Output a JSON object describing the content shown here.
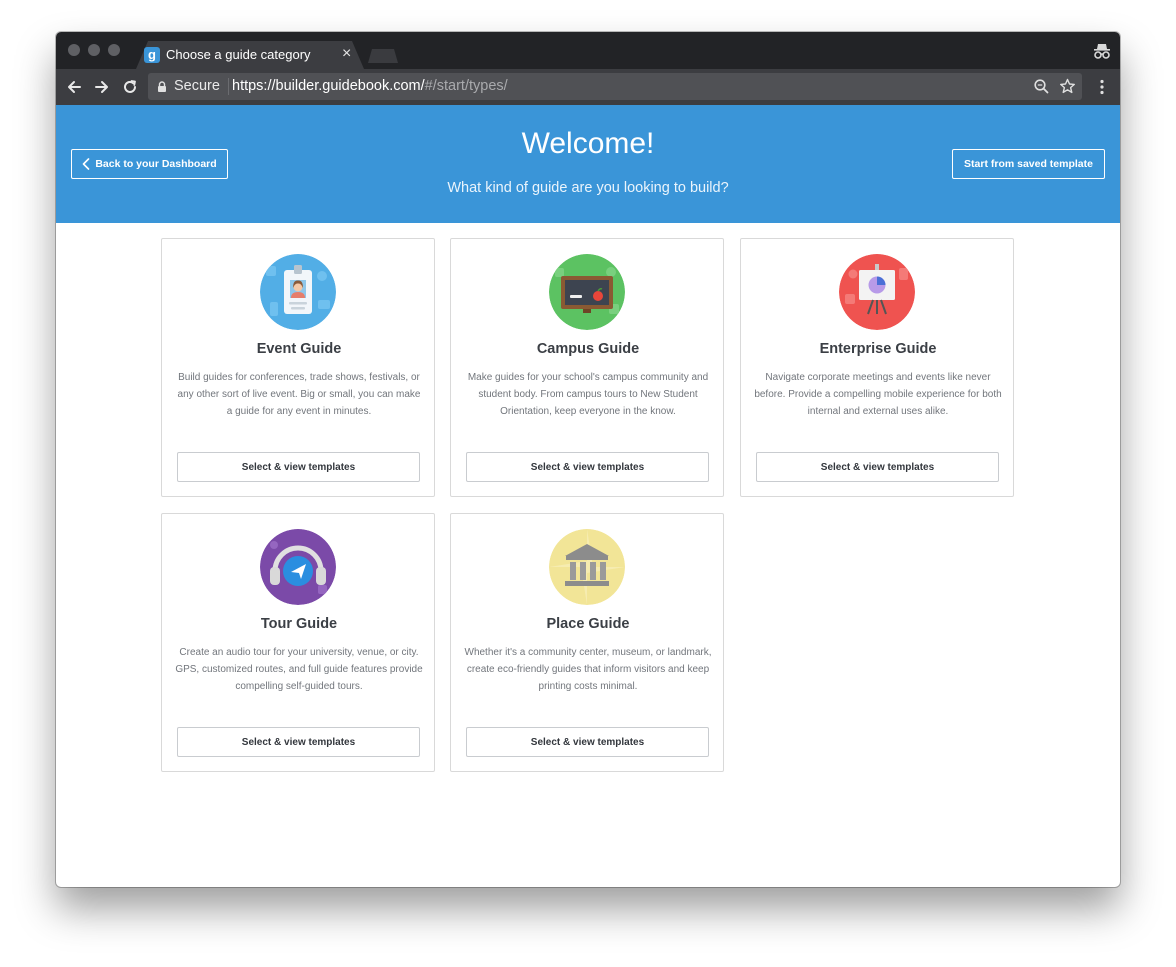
{
  "browser": {
    "tab_title": "Choose a guide category",
    "favicon_letter": "g",
    "secure_label": "Secure",
    "url_host": "https://builder.guidebook.com/",
    "url_path": "#/start/types/"
  },
  "header": {
    "title": "Welcome!",
    "subtitle": "What kind of guide are you looking to build?",
    "back_label": "Back to your Dashboard",
    "saved_template_label": "Start from saved template",
    "background_color": "#3a95d8"
  },
  "cards": [
    {
      "title": "Event Guide",
      "description": "Build guides for conferences, trade shows, festivals, or any other sort of live event. Big or small, you can make a guide for any event in minutes.",
      "button": "Select & view templates",
      "icon": "id-badge-icon",
      "icon_color": "#52aee6"
    },
    {
      "title": "Campus Guide",
      "description": "Make guides for your school's campus community and student body. From campus tours to New Student Orientation, keep everyone in the know.",
      "button": "Select & view templates",
      "icon": "chalkboard-icon",
      "icon_color": "#5cc262"
    },
    {
      "title": "Enterprise Guide",
      "description": "Navigate corporate meetings and events like never before. Provide a compelling mobile experience for both internal and external uses alike.",
      "button": "Select & view templates",
      "icon": "presentation-icon",
      "icon_color": "#ef5350"
    },
    {
      "title": "Tour Guide",
      "description": "Create an audio tour for your university, venue, or city. GPS, customized routes, and full guide features provide compelling self-guided tours.",
      "button": "Select & view templates",
      "icon": "audio-tour-icon",
      "icon_color": "#7b4aa8"
    },
    {
      "title": "Place Guide",
      "description": "Whether it's a community center, museum, or landmark, create eco-friendly guides that inform visitors and keep printing costs minimal.",
      "button": "Select & view templates",
      "icon": "museum-icon",
      "icon_color": "#f2e597"
    }
  ]
}
